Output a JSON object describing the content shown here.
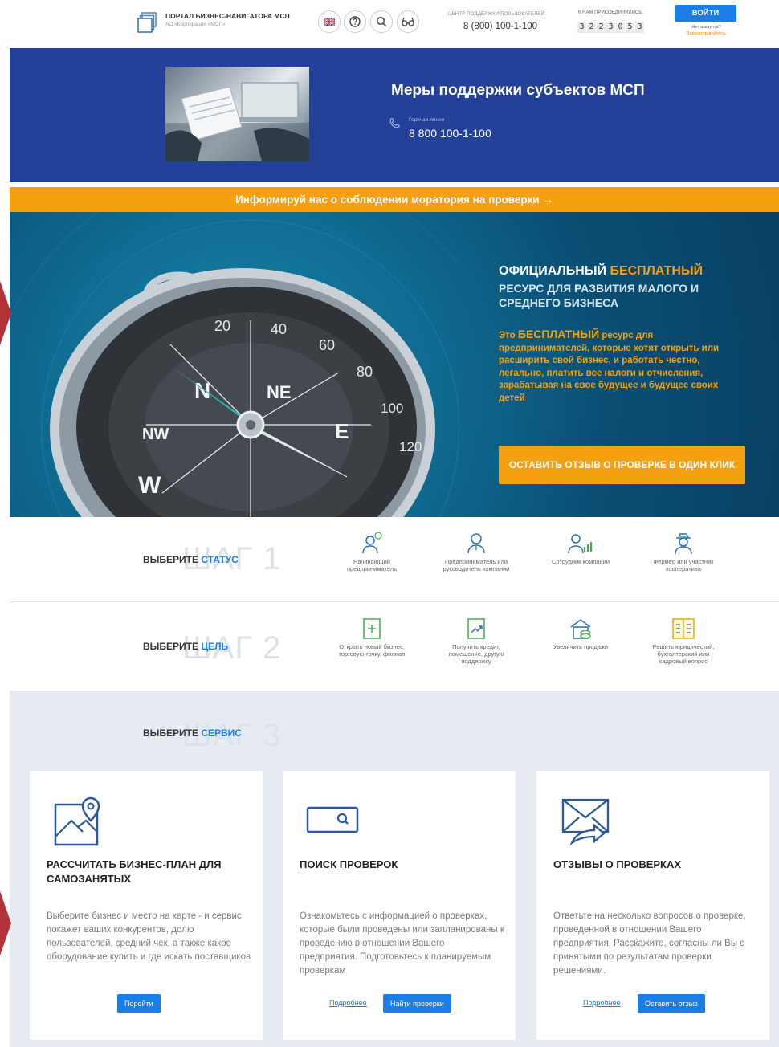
{
  "header": {
    "logo_title": "ПОРТАЛ БИЗНЕС-НАВИГАТОРА МСП",
    "logo_subtitle": "АО «Корпорация «МСП»",
    "icons": [
      "flag-uk-icon",
      "help-icon",
      "search-icon",
      "glasses-icon"
    ],
    "support_label": "ЦЕНТР ПОДДЕРЖКИ ПОЛЬЗОВАТЕЛЕЙ:",
    "support_phone": "8 (800) 100-1-100",
    "joined_label": "К НАМ ПРИСОЕДИНИЛИСЬ:",
    "joined_count": [
      "3",
      "2",
      "2",
      "3",
      "0",
      "5",
      "3"
    ],
    "login_label": "ВОЙТИ",
    "no_account": "Нет аккаунта?",
    "register_link": "Зарегистрируйтесь"
  },
  "banner": {
    "title": "Меры поддержки субъектов МСП",
    "hotline_label": "Горячая линия",
    "hotline_phone": "8 800 100-1-100"
  },
  "strip": {
    "text": "Информируй нас о соблюдении моратория на проверки  →"
  },
  "hero": {
    "line1_prefix": "ОФИЦИАЛЬНЫЙ ",
    "line1_highlight": "БЕСПЛАТНЫЙ",
    "line2": "РЕСУРС ДЛЯ РАЗВИТИЯ МАЛОГО И СРЕДНЕГО БИЗНЕСА",
    "desc_prefix": "Это ",
    "desc_highlight": "БЕСПЛАТНЫЙ",
    "desc_rest": " ресурс для предпринимателей, которые хотят открыть или расширить свой бизнес, и работать честно, легально, платить все налоги и отчисления, зарабатывая на свое будущее и будущее своих детей",
    "cta_label": "ОСТАВИТЬ ОТЗЫВ О ПРОВЕРКЕ В ОДИН КЛИК"
  },
  "steps": [
    {
      "ghost": "ШАГ 1",
      "label_prefix": "ВЫБЕРИТЕ ",
      "label_accent": "СТАТУС",
      "options": [
        {
          "icon": "beginner-entrepreneur-icon",
          "text": "Начинающий предприниматель"
        },
        {
          "icon": "entrepreneur-icon",
          "text": "Предприниматель или руководитель компании"
        },
        {
          "icon": "employee-icon",
          "text": "Сотрудник компании"
        },
        {
          "icon": "farmer-icon",
          "text": "Фермер или участник кооператива"
        }
      ]
    },
    {
      "ghost": "ШАГ 2",
      "label_prefix": "ВЫБЕРИТЕ ",
      "label_accent": "ЦЕЛЬ",
      "options": [
        {
          "icon": "new-business-icon",
          "text": "Открыть новый бизнес, торговую точку, филиал"
        },
        {
          "icon": "credit-icon",
          "text": "Получить кредит, помещение, другую поддержку"
        },
        {
          "icon": "sales-icon",
          "text": "Увеличить продажи"
        },
        {
          "icon": "legal-question-icon",
          "text": "Решить юридический, бухгалтерский или кадровый вопрос"
        }
      ]
    },
    {
      "ghost": "ШАГ 3",
      "label_prefix": "ВЫБЕРИТЕ ",
      "label_accent": "СЕРВИС"
    }
  ],
  "cards": [
    {
      "icon": "map-pin-icon",
      "title": "РАССЧИТАТЬ БИЗНЕС-ПЛАН ДЛЯ САМОЗАНЯТЫХ",
      "desc": "Выберите бизнес и место на карте - и сервис покажет ваших конкурентов, долю пользователей, средний чек, а также какое оборудование купить и где искать поставщиков",
      "button": "Перейти"
    },
    {
      "icon": "search-inspections-icon",
      "title": "ПОИСК ПРОВЕРОК",
      "desc": "Ознакомьтесь с информацией о проверках, которые были проведены или запланированы к проведению в отношении Вашего предприятия. Подготовьтесь к планируемым проверкам",
      "link": "Подробнее",
      "button": "Найти проверки"
    },
    {
      "icon": "envelope-icon",
      "title": "ОТЗЫВЫ О ПРОВЕРКАХ",
      "desc": "Ответьте на несколько вопросов о проверке, проведенной в отношении Вашего предприятия. Расскажите, согласны ли Вы с принятыми по результатам проверки решениями.",
      "link": "Подробнее",
      "button": "Оставить отзыв"
    }
  ],
  "colors": {
    "accent_blue": "#1a7ee6",
    "banner_blue": "#24419a",
    "orange": "#f5a00f",
    "icon_blue": "#2a6fb0",
    "icon_green": "#3cae4a",
    "side_tab_red": "#b2323a"
  }
}
